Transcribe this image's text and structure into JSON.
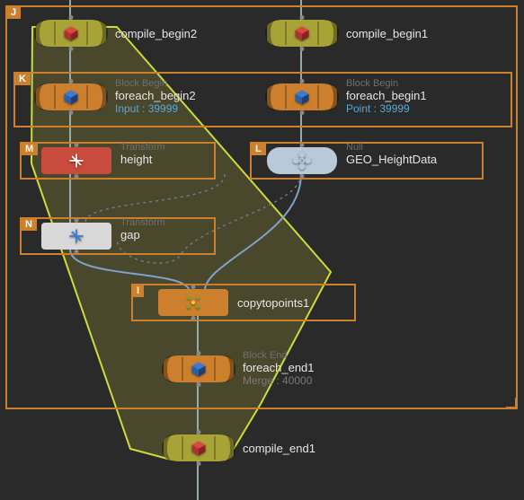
{
  "groups": {
    "J": {
      "label": "J",
      "color": "#cc7f2d"
    },
    "K": {
      "label": "K",
      "color": "#cc7f2d"
    },
    "M": {
      "label": "M",
      "color": "#cc7f2d"
    },
    "N": {
      "label": "N",
      "color": "#cc7f2d"
    },
    "L": {
      "label": "L",
      "color": "#cc7f2d"
    },
    "I": {
      "label": "I",
      "color": "#cc7f2d"
    }
  },
  "nodes": {
    "compile_begin2": {
      "label": "compile_begin2"
    },
    "compile_begin1": {
      "label": "compile_begin1"
    },
    "foreach_begin2": {
      "type": "Block Begin",
      "label": "foreach_begin2",
      "info": "Input : 39999"
    },
    "foreach_begin1": {
      "type": "Block Begin",
      "label": "foreach_begin1",
      "info": "Point : 39999"
    },
    "height": {
      "type": "Transform",
      "label": "height"
    },
    "geo_heightdata": {
      "type": "Null",
      "label": "GEO_HeightData"
    },
    "gap": {
      "type": "Transform",
      "label": "gap"
    },
    "copytopoints1": {
      "label": "copytopoints1"
    },
    "foreach_end1": {
      "type": "Block End",
      "label": "foreach_end1",
      "info": "Merge : 40000"
    },
    "compile_end1": {
      "label": "compile_end1"
    }
  }
}
